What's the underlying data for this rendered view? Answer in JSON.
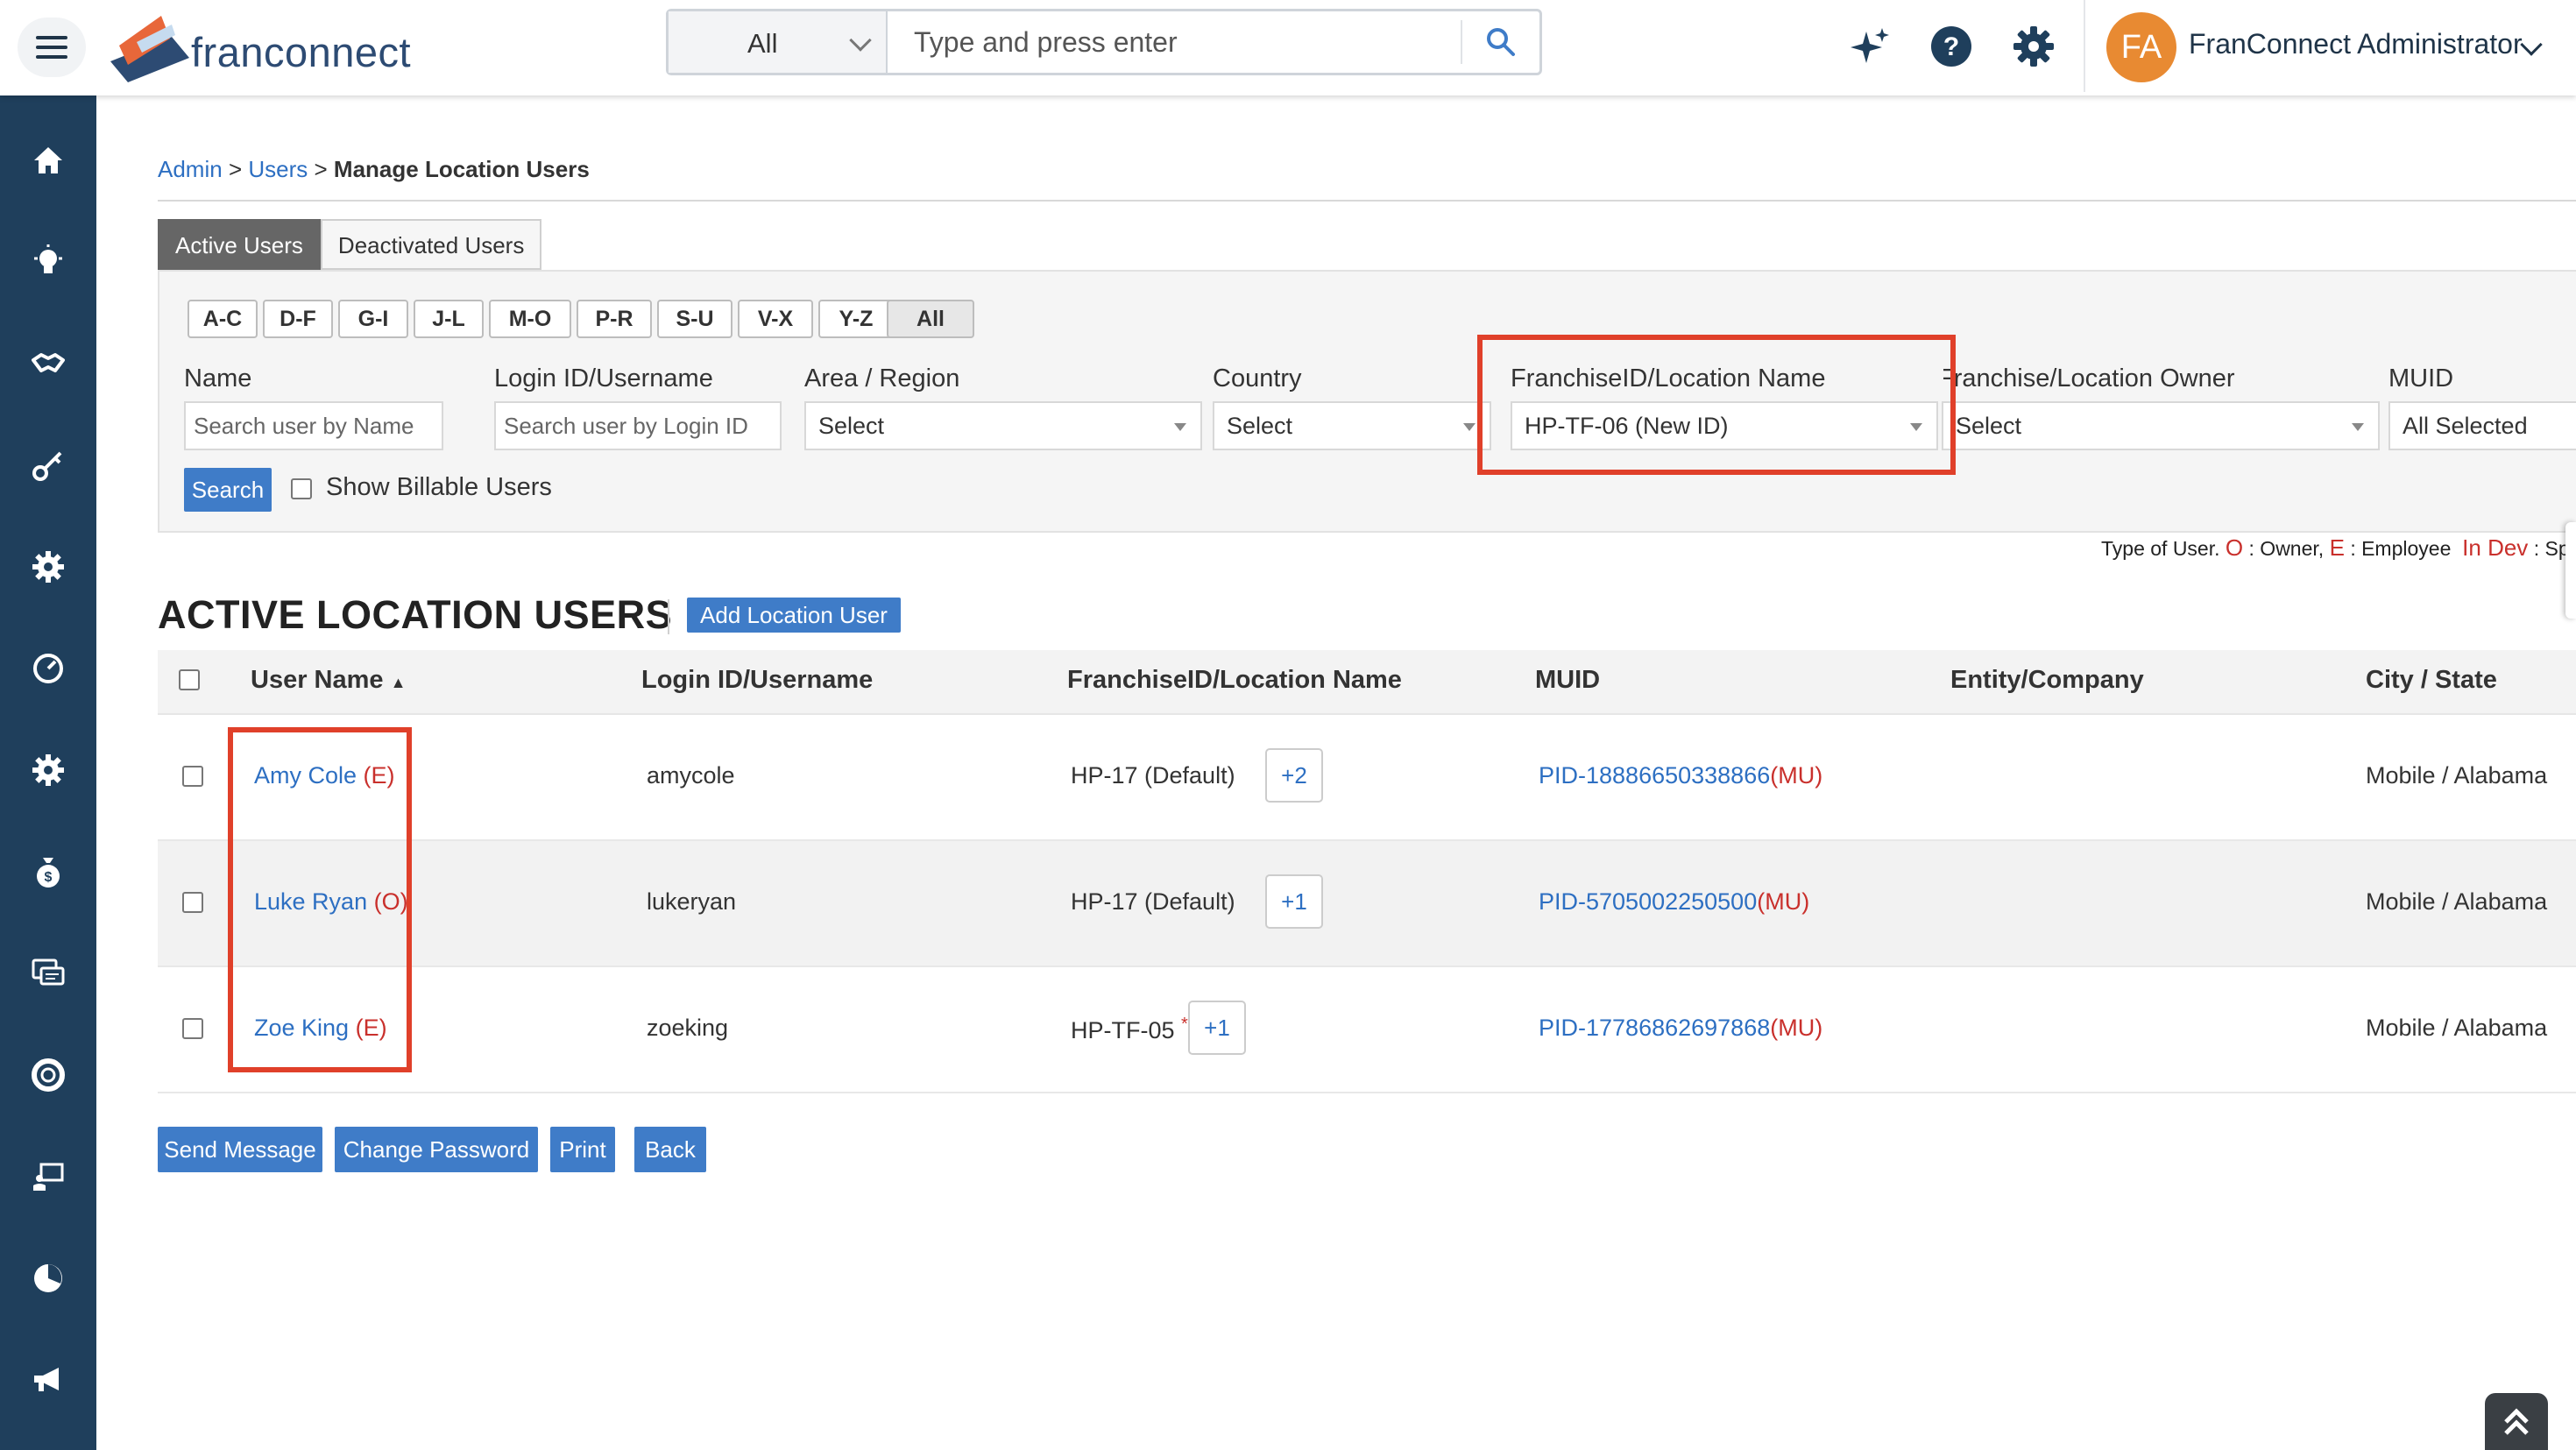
{
  "header": {
    "logo_text": "franconnect",
    "search": {
      "scope": "All",
      "placeholder": "Type and press enter"
    },
    "user": {
      "initials": "FA",
      "name": "FranConnect Administrator"
    }
  },
  "breadcrumb": {
    "admin": "Admin",
    "sep1": ">",
    "users": "Users",
    "sep2": ">",
    "current": "Manage Location Users"
  },
  "tabs": {
    "active": "Active Users",
    "deactivated": "Deactivated Users"
  },
  "alpha_filters": [
    "A-C",
    "D-F",
    "G-I",
    "J-L",
    "M-O",
    "P-R",
    "S-U",
    "V-X",
    "Y-Z",
    "All"
  ],
  "filters": {
    "name": {
      "label": "Name",
      "placeholder": "Search user by Name"
    },
    "login": {
      "label": "Login ID/Username",
      "placeholder": "Search user by Login ID"
    },
    "area": {
      "label": "Area / Region",
      "value": "Select"
    },
    "country": {
      "label": "Country",
      "value": "Select"
    },
    "franchise_id": {
      "label": "FranchiseID/Location Name",
      "value": "HP-TF-06 (New ID)"
    },
    "owner": {
      "label": "Franchise/Location Owner",
      "value": "Select"
    },
    "muid": {
      "label": "MUID",
      "value": "All Selected"
    },
    "search_button": "Search",
    "billable_label": "Show Billable Users"
  },
  "legend": {
    "prefix": "Type of User.",
    "o": "O",
    "o_text": ": Owner,",
    "e": "E",
    "e_text": ": Employee",
    "dev": "In Dev",
    "dev_text": ": Speci"
  },
  "section": {
    "title": "ACTIVE LOCATION USERS",
    "add_button": "Add Location User"
  },
  "table": {
    "headers": {
      "user_name": "User Name",
      "sort_icon": "▲",
      "login": "Login ID/Username",
      "franchise": "FranchiseID/Location Name",
      "muid": "MUID",
      "entity": "Entity/Company",
      "city": "City / State"
    },
    "rows": [
      {
        "name": "Amy Cole",
        "type": "(E)",
        "login": "amycole",
        "franchise": "HP-17 (Default)",
        "star": "",
        "more": "+2",
        "muid": "PID-18886650338866",
        "muid_tag": "(MU)",
        "entity": "",
        "city": "Mobile / Alabama"
      },
      {
        "name": "Luke Ryan",
        "type": "(O)",
        "login": "lukeryan",
        "franchise": "HP-17 (Default)",
        "star": "",
        "more": "+1",
        "muid": "PID-5705002250500",
        "muid_tag": "(MU)",
        "entity": "",
        "city": "Mobile / Alabama"
      },
      {
        "name": "Zoe King",
        "type": "(E)",
        "login": "zoeking",
        "franchise": "HP-TF-05",
        "star": "*",
        "more": "+1",
        "muid": "PID-17786862697868",
        "muid_tag": "(MU)",
        "entity": "",
        "city": "Mobile / Alabama"
      }
    ]
  },
  "actions": {
    "send_message": "Send Message",
    "change_password": "Change Password",
    "print": "Print",
    "back": "Back"
  },
  "icons": {
    "sidebar": [
      "home-icon",
      "lightbulb-icon",
      "handshake-icon",
      "key-icon",
      "gear-icon",
      "gauge-icon",
      "gear-icon",
      "money-bag-icon",
      "chat-icon",
      "lifebuoy-icon",
      "training-icon",
      "pie-icon",
      "megaphone-icon"
    ],
    "top": [
      "sparkle-icon",
      "help-icon",
      "settings-icon"
    ]
  },
  "colors": {
    "sidebar": "#1f3f5c",
    "accent": "#3f7cc8",
    "link": "#2d6fc2",
    "highlight": "#e0402a",
    "avatar": "#e88a32"
  }
}
